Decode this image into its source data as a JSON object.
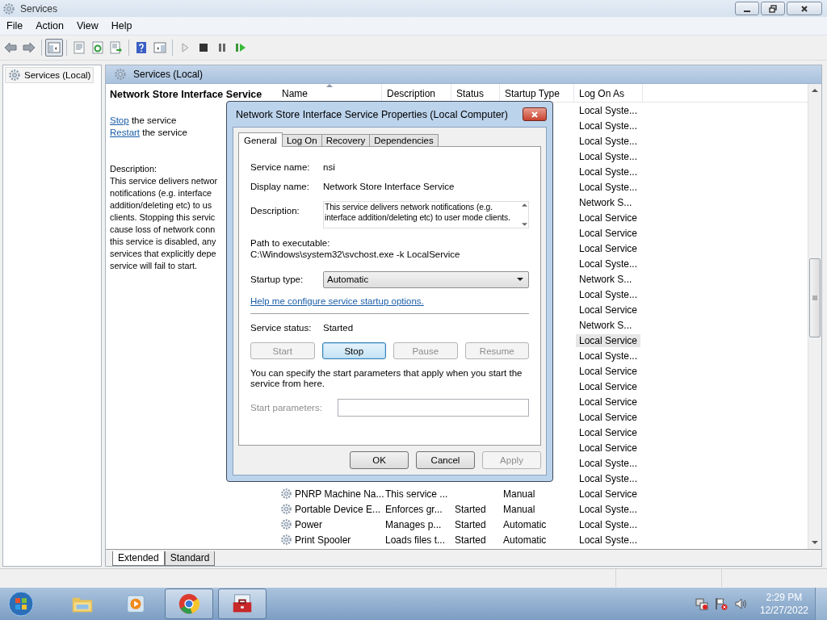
{
  "window": {
    "title": "Services"
  },
  "menu": [
    {
      "label": "File"
    },
    {
      "label": "Action"
    },
    {
      "label": "View"
    },
    {
      "label": "Help"
    }
  ],
  "toolbar": [
    {
      "kind": "back",
      "pressed": false
    },
    {
      "kind": "forward",
      "pressed": false
    },
    {
      "kind": "tree",
      "pressed": true
    },
    {
      "kind": "properties",
      "pressed": false
    },
    {
      "kind": "refresh",
      "pressed": false
    },
    {
      "kind": "export",
      "pressed": false
    },
    {
      "kind": "help",
      "pressed": false
    },
    {
      "kind": "actionpane",
      "pressed": false
    },
    {
      "kind": "play",
      "pressed": false
    },
    {
      "kind": "stop",
      "pressed": false
    },
    {
      "kind": "pause",
      "pressed": false
    },
    {
      "kind": "restart",
      "pressed": false
    }
  ],
  "tree": [
    {
      "label": "Services (Local)",
      "selected": true
    }
  ],
  "panel": {
    "title": "Services (Local)"
  },
  "details": {
    "heading": "Network Store Interface Service",
    "actions": [
      {
        "link": "Stop",
        "text": "the service"
      },
      {
        "link": "Restart",
        "text": "the service"
      }
    ],
    "description_label": "Description:",
    "description_lines": [
      "This service delivers networ",
      "notifications (e.g. interface",
      "addition/deleting etc) to us",
      "clients. Stopping this servic",
      "cause loss of network conn",
      "this service is disabled, any",
      "services that explicitly depe",
      "service will fail to start."
    ]
  },
  "table": {
    "columns": [
      {
        "label": "Name",
        "sorted": true
      },
      {
        "label": "Description",
        "sorted": false
      },
      {
        "label": "Status",
        "sorted": false
      },
      {
        "label": "Startup Type",
        "sorted": false
      },
      {
        "label": "Log On As",
        "sorted": false
      }
    ],
    "rows": [
      {
        "logon": "Local Syste...",
        "selected": false
      },
      {
        "logon": "Local Syste...",
        "selected": false
      },
      {
        "logon": "Local Syste...",
        "selected": false
      },
      {
        "logon": "Local Syste...",
        "selected": false
      },
      {
        "logon": "Local Syste...",
        "selected": false
      },
      {
        "logon": "Local Syste...",
        "selected": false
      },
      {
        "logon": "Network S...",
        "selected": false
      },
      {
        "logon": "Local Service",
        "selected": false
      },
      {
        "logon": "Local Service",
        "selected": false
      },
      {
        "logon": "Local Service",
        "selected": false
      },
      {
        "logon": "Local Syste...",
        "selected": false
      },
      {
        "logon": "Network S...",
        "selected": false
      },
      {
        "logon": "Local Syste...",
        "selected": false
      },
      {
        "logon": "Local Service",
        "selected": false
      },
      {
        "logon": "Network S...",
        "selected": false
      },
      {
        "logon": "Local Service",
        "selected": true
      },
      {
        "logon": "Local Syste...",
        "selected": false
      },
      {
        "logon": "Local Service",
        "selected": false
      },
      {
        "logon": "Local Service",
        "selected": false
      },
      {
        "logon": "Local Service",
        "selected": false
      },
      {
        "logon": "Local Service",
        "selected": false
      },
      {
        "logon": "Local Service",
        "selected": false
      },
      {
        "logon": "Local Service",
        "selected": false
      },
      {
        "logon": "Local Syste...",
        "selected": false
      },
      {
        "logon": "Local Syste...",
        "selected": false
      },
      {
        "name": "PNRP Machine Na...",
        "description": "This service ...",
        "startup": "Manual",
        "logon": "Local Service",
        "selected": false
      },
      {
        "name": "Portable Device E...",
        "description": "Enforces gr...",
        "status": "Started",
        "startup": "Manual",
        "logon": "Local Syste...",
        "selected": false
      },
      {
        "name": "Power",
        "description": "Manages p...",
        "status": "Started",
        "startup": "Automatic",
        "logon": "Local Syste...",
        "selected": false
      },
      {
        "name": "Print Spooler",
        "description": "Loads files t...",
        "status": "Started",
        "startup": "Automatic",
        "logon": "Local Syste...",
        "selected": false
      }
    ]
  },
  "view_tabs": [
    {
      "label": "Extended",
      "selected": true
    },
    {
      "label": "Standard",
      "selected": false
    }
  ],
  "dialog": {
    "title": "Network Store Interface Service Properties (Local Computer)",
    "tabs": [
      {
        "label": "General",
        "selected": true
      },
      {
        "label": "Log On",
        "selected": false
      },
      {
        "label": "Recovery",
        "selected": false
      },
      {
        "label": "Dependencies",
        "selected": false
      }
    ],
    "fields": [
      {
        "label": "Service name:",
        "value": "nsi"
      },
      {
        "label": "Display name:",
        "value": "Network Store Interface Service"
      }
    ],
    "description": {
      "label": "Description:",
      "value": "This service delivers network notifications (e.g. interface addition/deleting etc) to user mode clients."
    },
    "path": {
      "label": "Path to executable:",
      "value": "C:\\Windows\\system32\\svchost.exe -k LocalService"
    },
    "startup": {
      "label": "Startup type:",
      "value": "Automatic"
    },
    "help_link": "Help me configure service startup options.",
    "status": {
      "label": "Service status:",
      "value": "Started"
    },
    "service_buttons": [
      {
        "label": "Start",
        "disabled": true,
        "focused": false
      },
      {
        "label": "Stop",
        "disabled": false,
        "focused": true
      },
      {
        "label": "Pause",
        "disabled": true,
        "focused": false
      },
      {
        "label": "Resume",
        "disabled": true,
        "focused": false
      }
    ],
    "note": "You can specify the start parameters that apply when you start the service from here.",
    "parameters": {
      "label": "Start parameters:",
      "disabled": true
    },
    "buttons": [
      {
        "label": "OK",
        "disabled": false
      },
      {
        "label": "Cancel",
        "disabled": false
      },
      {
        "label": "Apply",
        "disabled": true
      }
    ]
  },
  "taskbar": {
    "apps": [
      {
        "kind": "folder",
        "active": false
      },
      {
        "kind": "media",
        "active": false
      },
      {
        "kind": "browser",
        "active": true
      },
      {
        "kind": "toolbox",
        "active": true
      }
    ],
    "time": "2:29 PM",
    "date": "12/27/2022"
  }
}
